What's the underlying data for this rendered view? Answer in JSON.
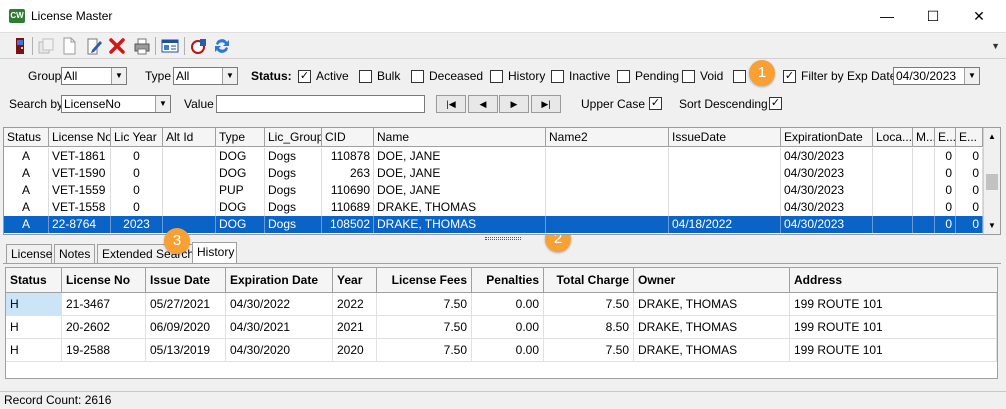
{
  "window": {
    "title": "License Master",
    "min_glyph": "—",
    "max_glyph": "☐",
    "close_glyph": "✕"
  },
  "toolbar": {
    "icons": [
      "exit-icon",
      "copy-record-icon",
      "new-record-icon",
      "edit-record-icon",
      "delete-icon",
      "print-icon",
      "view-details-icon",
      "renew-icon",
      "refresh-icon"
    ],
    "overflow_glyph": "▼"
  },
  "filters": {
    "group_label": "Group",
    "group_value": "All",
    "type_label": "Type",
    "type_value": "All",
    "status_label": "Status:",
    "statuses": [
      {
        "label": "Active",
        "checked": true
      },
      {
        "label": "Bulk",
        "checked": false
      },
      {
        "label": "Deceased",
        "checked": false
      },
      {
        "label": "History",
        "checked": false
      },
      {
        "label": "Inactive",
        "checked": false
      },
      {
        "label": "Pending",
        "checked": false
      },
      {
        "label": "Void",
        "checked": false
      },
      {
        "label": "",
        "checked": false
      }
    ],
    "filter_by_exp_label": "Filter by Exp Date",
    "filter_by_exp_checked": true,
    "exp_date_value": "04/30/2023",
    "search_by_label": "Search by",
    "search_by_value": "LicenseNo",
    "value_label": "Value",
    "value_text": "",
    "nav": [
      "|◀",
      "◀",
      "▶",
      "▶|"
    ],
    "upper_case_label": "Upper Case",
    "upper_case_checked": true,
    "sort_desc_label": "Sort Descending",
    "sort_desc_checked": true,
    "check_glyph": "✓",
    "arrow_glyph": "▼"
  },
  "callouts": [
    "1",
    "2",
    "3"
  ],
  "licenses_grid": {
    "columns": [
      "Status",
      "License No",
      "Lic Year",
      "Alt Id",
      "Type",
      "Lic_Group",
      "CID",
      "Name",
      "Name2",
      "IssueDate",
      "ExpirationDate",
      "Loca...",
      "M...",
      "E...",
      "E..."
    ],
    "rows": [
      [
        "A",
        "VET-1861",
        "0",
        "",
        "DOG",
        "Dogs",
        "110878",
        "DOE, JANE",
        "",
        "",
        "04/30/2023",
        "",
        "",
        "0",
        "0"
      ],
      [
        "A",
        "VET-1590",
        "0",
        "",
        "DOG",
        "Dogs",
        "263",
        "DOE, JANE",
        "",
        "",
        "04/30/2023",
        "",
        "",
        "0",
        "0"
      ],
      [
        "A",
        "VET-1559",
        "0",
        "",
        "PUP",
        "Dogs",
        "110690",
        "DOE, JANE",
        "",
        "",
        "04/30/2023",
        "",
        "",
        "0",
        "0"
      ],
      [
        "A",
        "VET-1558",
        "0",
        "",
        "DOG",
        "Dogs",
        "110689",
        "DRAKE, THOMAS",
        "",
        "",
        "04/30/2023",
        "",
        "",
        "0",
        "0"
      ],
      [
        "A",
        "22-8764",
        "2023",
        "",
        "DOG",
        "Dogs",
        "108502",
        "DRAKE, THOMAS",
        "",
        "04/18/2022",
        "04/30/2023",
        "",
        "",
        "0",
        "0"
      ]
    ],
    "selected_row": 4
  },
  "tabs": [
    "License",
    "Notes",
    "Extended Search",
    "History"
  ],
  "active_tab": "History",
  "history_grid": {
    "columns": [
      "Status",
      "License No",
      "Issue Date",
      "Expiration Date",
      "Year",
      "License Fees",
      "Penalties",
      "Total Charge",
      "Owner",
      "Address"
    ],
    "rows": [
      [
        "H",
        "21-3467",
        "05/27/2021",
        "04/30/2022",
        "2022",
        "7.50",
        "0.00",
        "7.50",
        "DRAKE, THOMAS",
        "199 ROUTE 101"
      ],
      [
        "H",
        "20-2602",
        "06/09/2020",
        "04/30/2021",
        "2021",
        "7.50",
        "0.00",
        "8.50",
        "DRAKE, THOMAS",
        "199 ROUTE 101"
      ],
      [
        "H",
        "19-2588",
        "05/13/2019",
        "04/30/2020",
        "2020",
        "7.50",
        "0.00",
        "7.50",
        "DRAKE, THOMAS",
        "199 ROUTE 101"
      ]
    ]
  },
  "status_bar": {
    "text": "Record Count: 2616"
  },
  "colors": {
    "selection": "#0a64c8",
    "callout": "#f7a135",
    "cell_highlight": "#cce4f7"
  }
}
